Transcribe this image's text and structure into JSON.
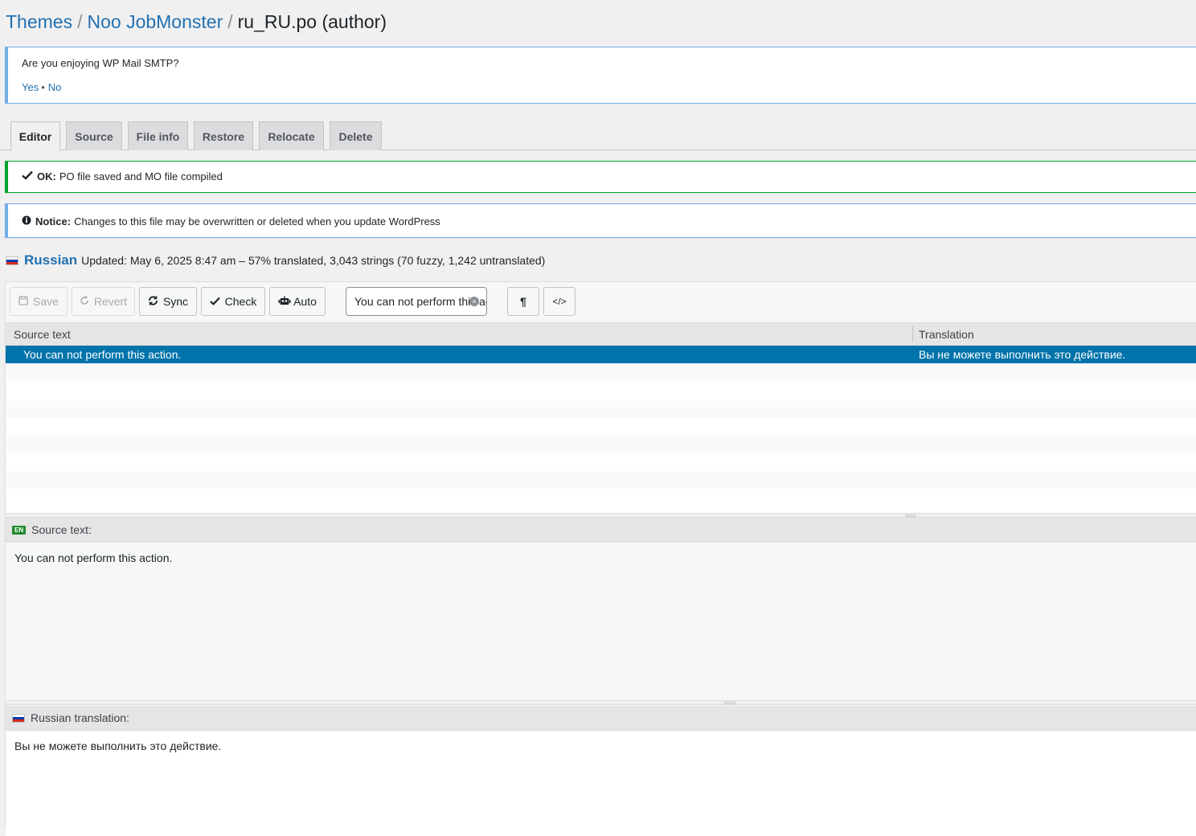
{
  "breadcrumb": {
    "themes": "Themes",
    "sep": "/",
    "theme": "Noo JobMonster",
    "file": "ru_RU.po (author)"
  },
  "smtp_notice": {
    "question": "Are you enjoying WP Mail SMTP?",
    "yes": "Yes",
    "dot": "•",
    "no": "No"
  },
  "tabs": [
    "Editor",
    "Source",
    "File info",
    "Restore",
    "Relocate",
    "Delete"
  ],
  "ok_notice": {
    "label": "OK:",
    "text": "PO file saved and MO file compiled"
  },
  "info_notice": {
    "label": "Notice:",
    "text": "Changes to this file may be overwritten or deleted when you update WordPress"
  },
  "language": {
    "name": "Russian",
    "meta": "Updated: May 6, 2025 8:47 am – 57% translated, 3,043 strings (70 fuzzy, 1,242 untranslated)"
  },
  "toolbar": {
    "save": "Save",
    "revert": "Revert",
    "sync": "Sync",
    "check": "Check",
    "auto": "Auto",
    "search_value": "You can not perform this action.",
    "pilcrow": "¶",
    "code": "</>"
  },
  "grid": {
    "col_source": "Source text",
    "col_translation": "Translation",
    "selected_source": "You can not perform this action.",
    "selected_translation": "Вы не можете выполнить это действие."
  },
  "source_pane": {
    "badge": "EN",
    "title": "Source text:",
    "text": "You can not perform this action."
  },
  "translation_pane": {
    "title": "Russian translation:",
    "text": "Вы не можете выполнить это действие."
  }
}
